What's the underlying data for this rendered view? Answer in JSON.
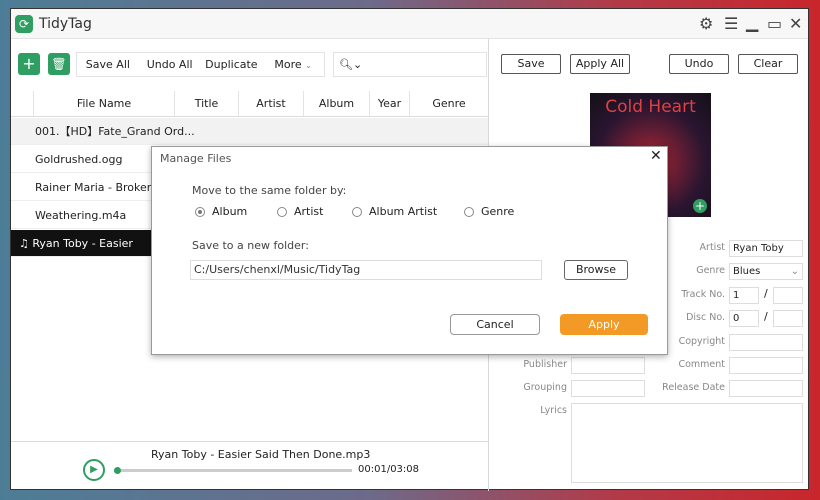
{
  "app": {
    "title": "TidyTag"
  },
  "toolbar": {
    "save_all": "Save All",
    "undo_all": "Undo All",
    "duplicate": "Duplicate",
    "more": "More"
  },
  "table": {
    "headers": [
      "File Name",
      "Title",
      "Artist",
      "Album",
      "Year",
      "Genre"
    ],
    "rows": [
      "001.【HD】Fate_Grand Ord...",
      "Goldrushed.ogg",
      "Rainer Maria - Broken R",
      "Weathering.m4a",
      "Ryan Toby - Easier Said"
    ]
  },
  "player": {
    "track": "Ryan Toby - Easier Said Then Done.mp3",
    "time": "00:01/03:08",
    "progress": 0.005
  },
  "right": {
    "save": "Save",
    "apply_all": "Apply All",
    "undo": "Undo",
    "clear": "Clear",
    "art_text": "Cold Heart",
    "fields": {
      "artist_label": "Artist",
      "artist": "Ryan Toby",
      "genre_label": "Genre",
      "genre": "Blues",
      "track_label": "Track No.",
      "track": "1",
      "disc_label": "Disc No.",
      "disc": "0",
      "copyright_label": "Copyright",
      "publisher_label": "Publisher",
      "comment_label": "Comment",
      "grouping_label": "Grouping",
      "release_label": "Release Date",
      "lyrics_label": "Lyrics"
    }
  },
  "dialog": {
    "title": "Manage Files",
    "move_label": "Move to the same folder by:",
    "options": [
      "Album",
      "Artist",
      "Album Artist",
      "Genre"
    ],
    "selected": "Album",
    "save_label": "Save to a new folder:",
    "path": "C:/Users/chenxl/Music/TidyTag",
    "browse": "Browse",
    "cancel": "Cancel",
    "apply": "Apply"
  },
  "colors": {
    "green": "#2f9e62",
    "orange": "#f39a26"
  }
}
